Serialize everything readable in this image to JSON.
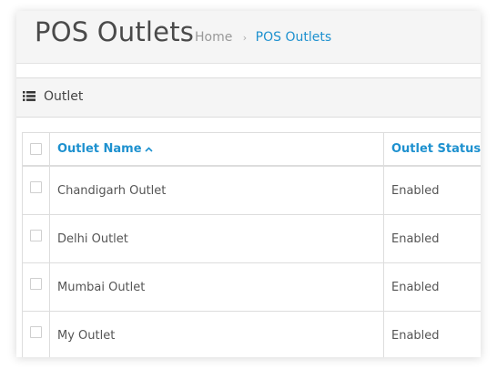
{
  "header": {
    "title": "POS Outlets",
    "breadcrumb": [
      "Home",
      "POS Outlets"
    ],
    "breadcrumb_separator": "›"
  },
  "section": {
    "title": "Outlet",
    "icon": "list-icon"
  },
  "table": {
    "columns": [
      {
        "label": "Outlet Name",
        "sort": "ascending",
        "sort_icon": "chevron-up-icon"
      },
      {
        "label": "Outlet Status"
      }
    ],
    "rows": [
      {
        "name": "Chandigarh Outlet",
        "status": "Enabled"
      },
      {
        "name": "Delhi Outlet",
        "status": "Enabled"
      },
      {
        "name": "Mumbai Outlet",
        "status": "Enabled"
      },
      {
        "name": "My Outlet",
        "status": "Enabled"
      }
    ]
  },
  "colors": {
    "link": "#1e91cf",
    "header_background": "#f5f5f5",
    "border": "#dddddd"
  }
}
